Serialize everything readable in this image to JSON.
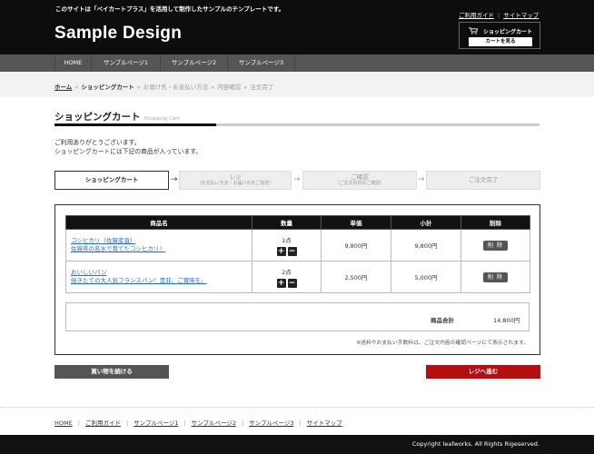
{
  "header": {
    "tagline": "このサイトは「ペイカートプラス」を活用して制作したサンプルのテンプレートです。",
    "logo": "Sample Design",
    "links": [
      "ご利用ガイド",
      "サイトマップ"
    ],
    "cart_title": "ショッピングカート",
    "cart_button": "カートを見る"
  },
  "nav": [
    "HOME",
    "サンプルページ1",
    "サンプルページ2",
    "サンプルページ3"
  ],
  "breadcrumb": {
    "home": "ホーム",
    "current": "ショッピングカート",
    "rest": [
      "お届け先・お支払い方法",
      "内容確認",
      "注文完了"
    ]
  },
  "title": {
    "main": "ショッピングカート",
    "sub": "Shopping Cart"
  },
  "intro": [
    "ご利用ありがとうございます。",
    "ショッピングカートには下記の商品が入っています。"
  ],
  "steps": [
    {
      "l1": "ショッピングカート",
      "l2": ""
    },
    {
      "l1": "レジ",
      "l2": "（お支払い方法・お届け先をご指定）"
    },
    {
      "l1": "ご確認",
      "l2": "（ご注文内容のご確認）"
    },
    {
      "l1": "ご注文完了",
      "l2": ""
    }
  ],
  "table": {
    "headers": [
      "商品名",
      "数量",
      "単価",
      "小計",
      "削除"
    ],
    "rows": [
      {
        "name1": "コシヒカリ（佐賀産直）",
        "name2": "佐賀県の名水で育てたコシヒカリ！",
        "qty": "1点",
        "price": "9,800円",
        "subtotal": "9,800円",
        "delete": "削 除"
      },
      {
        "name1": "おいしいパン",
        "name2": "焼きたての大人気フランスパン！是非、ご賞味を。",
        "qty": "2点",
        "price": "2,500円",
        "subtotal": "5,000円",
        "delete": "削 除"
      }
    ],
    "plus": "+",
    "minus": "−"
  },
  "total": {
    "label": "商品合計",
    "value": "14,800円"
  },
  "note": "※送料やお支払い手数料は、ご注文内容の確認ページにて表示されます。",
  "buttons": {
    "continue": "買い物を続ける",
    "checkout": "レジへ進む"
  },
  "footer": {
    "links": [
      "HOME",
      "ご利用ガイド",
      "サンプルページ1",
      "サンプルページ2",
      "サンプルページ3",
      "サイトマップ"
    ],
    "copyright": "Copyright leafworks. All Rights Rigeserved."
  },
  "colors": {
    "header_bg": "#0d0d0d",
    "nav_bg": "#555555",
    "checkout": "#b01010",
    "link": "#2a6fbd"
  },
  "icons": {
    "cart": "shopping-cart-icon",
    "step_arrow_active": "→",
    "step_arrow": "→"
  }
}
